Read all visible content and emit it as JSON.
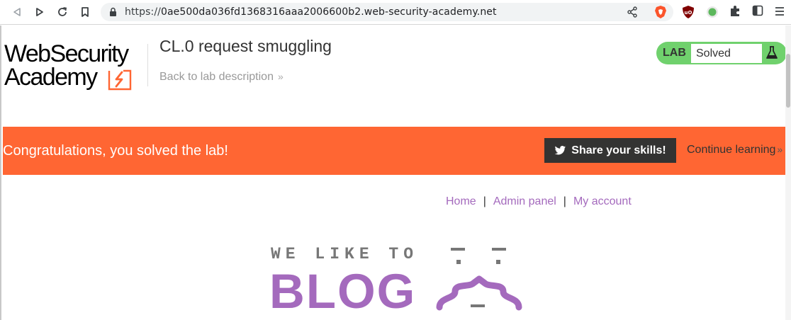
{
  "browser": {
    "url_scheme": "https://",
    "url_host": "0ae500da036fd1368316aaa2006600b2.web-security-academy.net",
    "icons": [
      "back-icon",
      "forward-icon",
      "reload-icon",
      "bookmark-icon",
      "lock-icon",
      "share-icon",
      "brave-icon",
      "ublock-icon",
      "extension-green-icon",
      "puzzle-icon",
      "sidebar-icon",
      "menu-icon"
    ]
  },
  "header": {
    "logo_line1": "WebSecurity",
    "logo_line2": "Academy",
    "lab_title": "CL.0 request smuggling",
    "back_link": "Back to lab description",
    "back_chevron": "»",
    "lab_badge": "LAB",
    "lab_status": "Solved"
  },
  "banner": {
    "message": "Congratulations, you solved the lab!",
    "share_button": "Share your skills!",
    "continue_link": "Continue learning",
    "continue_chevron": "»"
  },
  "nav": {
    "items": [
      "Home",
      "Admin panel",
      "My account"
    ],
    "separator": "|"
  },
  "blog_logo": {
    "tagline": "WE LIKE TO",
    "word": "BLOG"
  },
  "colors": {
    "accent_orange": "#ff6633",
    "status_green": "#70d16d",
    "link_purple": "#a46abd",
    "share_bg": "#333332"
  }
}
